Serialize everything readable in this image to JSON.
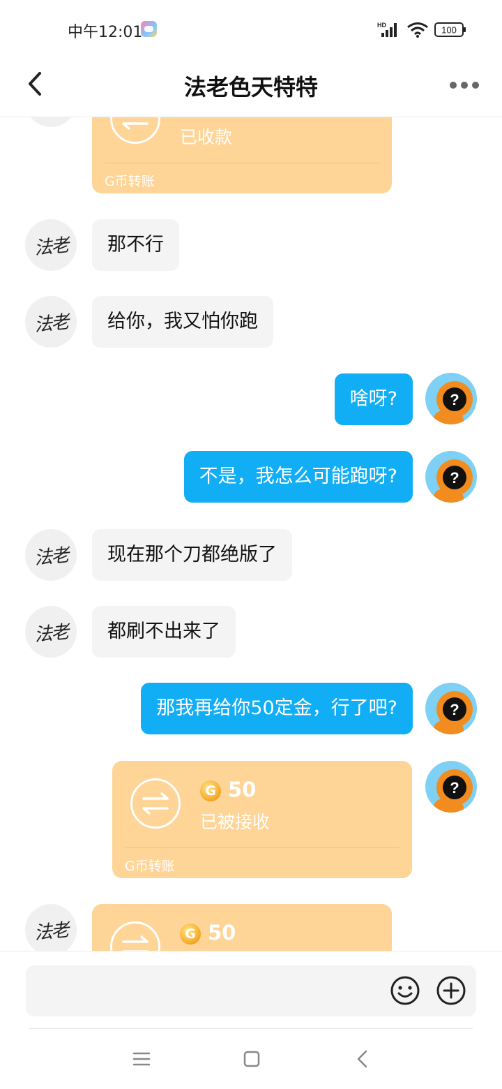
{
  "status_bar": {
    "time": "中午12:01",
    "network_type": "HD",
    "battery": "100",
    "icons": [
      "game-app-icon",
      "signal-icon",
      "wifi-icon",
      "battery-icon"
    ]
  },
  "header": {
    "title": "法老色天特特",
    "back_icon": "chevron-left-icon",
    "more_icon": "more-dots-icon"
  },
  "contact": {
    "avatar_text": "法老"
  },
  "messages": [
    {
      "side": "left",
      "type": "transfer",
      "amount": "",
      "status": "已收款",
      "label": "G币转账"
    },
    {
      "side": "left",
      "type": "text",
      "text": "那不行"
    },
    {
      "side": "left",
      "type": "text",
      "text": "给你，我又怕你跑"
    },
    {
      "side": "right",
      "type": "text",
      "text": "啥呀?"
    },
    {
      "side": "right",
      "type": "text",
      "text": "不是，我怎么可能跑呀?"
    },
    {
      "side": "left",
      "type": "text",
      "text": "现在那个刀都绝版了"
    },
    {
      "side": "left",
      "type": "text",
      "text": "都刷不出来了"
    },
    {
      "side": "right",
      "type": "text",
      "text": "那我再给你50定金，行了吧?"
    },
    {
      "side": "right",
      "type": "transfer",
      "amount": "50",
      "status": "已被接收",
      "label": "G币转账"
    },
    {
      "side": "left",
      "type": "transfer",
      "amount": "50",
      "status": "",
      "label": ""
    }
  ],
  "coin_letter": "G",
  "input": {
    "value": "",
    "emoji_icon": "smiley-icon",
    "plus_icon": "plus-circle-icon"
  },
  "nav_bar": {
    "icons": [
      "menu-icon",
      "home-icon",
      "back-icon"
    ]
  },
  "colors": {
    "bubble_self": "#12aef5",
    "bubble_other": "#f4f4f4",
    "transfer_card": "#fed497",
    "avatar_self_bg": "#7ed0f5",
    "avatar_self_face": "#f28c1e"
  }
}
